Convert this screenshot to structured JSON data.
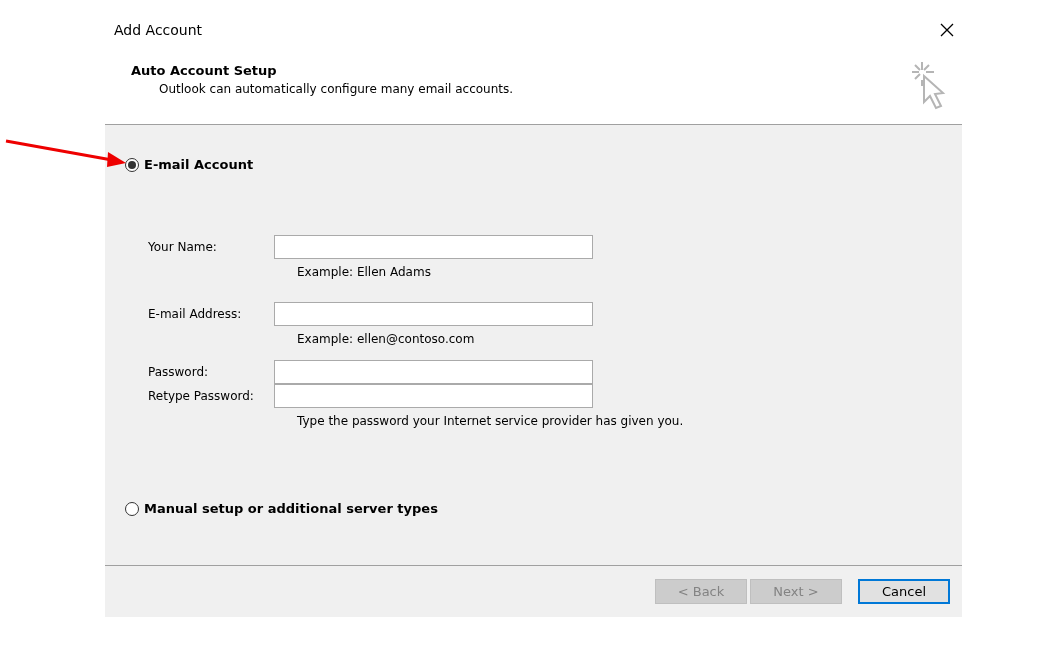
{
  "window": {
    "title": "Add Account"
  },
  "header": {
    "title": "Auto Account Setup",
    "subtitle": "Outlook can automatically configure many email accounts."
  },
  "options": [
    {
      "label": "E-mail Account",
      "selected": true
    },
    {
      "label": "Manual setup or additional server types",
      "selected": false
    }
  ],
  "fields": [
    {
      "label": "Your Name:",
      "note": "Example: Ellen Adams"
    },
    {
      "label": "E-mail Address:",
      "note": "Example: ellen@contoso.com"
    },
    {
      "label": "Password:"
    },
    {
      "label": "Retype Password:",
      "note": "Type the password your Internet service provider has given you."
    }
  ],
  "buttons": [
    {
      "label": "< Back",
      "disabled": true,
      "default": false
    },
    {
      "label": "Next >",
      "disabled": true,
      "default": false
    },
    {
      "label": "Cancel",
      "disabled": false,
      "default": true
    }
  ]
}
